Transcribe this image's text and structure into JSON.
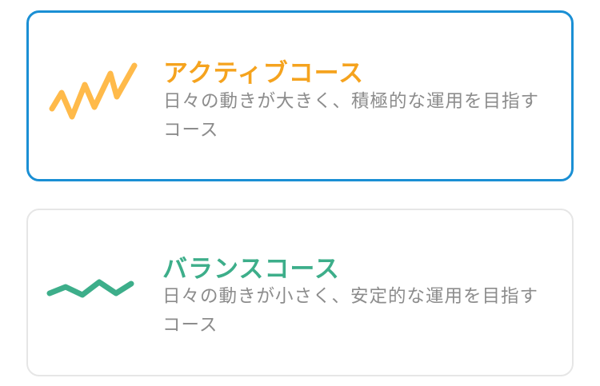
{
  "courses": [
    {
      "title": "アクティブコース",
      "description": "日々の動きが大きく、積極的な運用を目指すコース",
      "icon": "zigzag-chart-icon",
      "color": "#f5a31e",
      "selected": true
    },
    {
      "title": "バランスコース",
      "description": "日々の動きが小さく、安定的な運用を目指すコース",
      "icon": "wave-line-icon",
      "color": "#3dae8a",
      "selected": false
    }
  ],
  "colors": {
    "selected_border": "#1a8fd4",
    "unselected_border": "#e6e6e6",
    "description_text": "#8c8c8c"
  }
}
